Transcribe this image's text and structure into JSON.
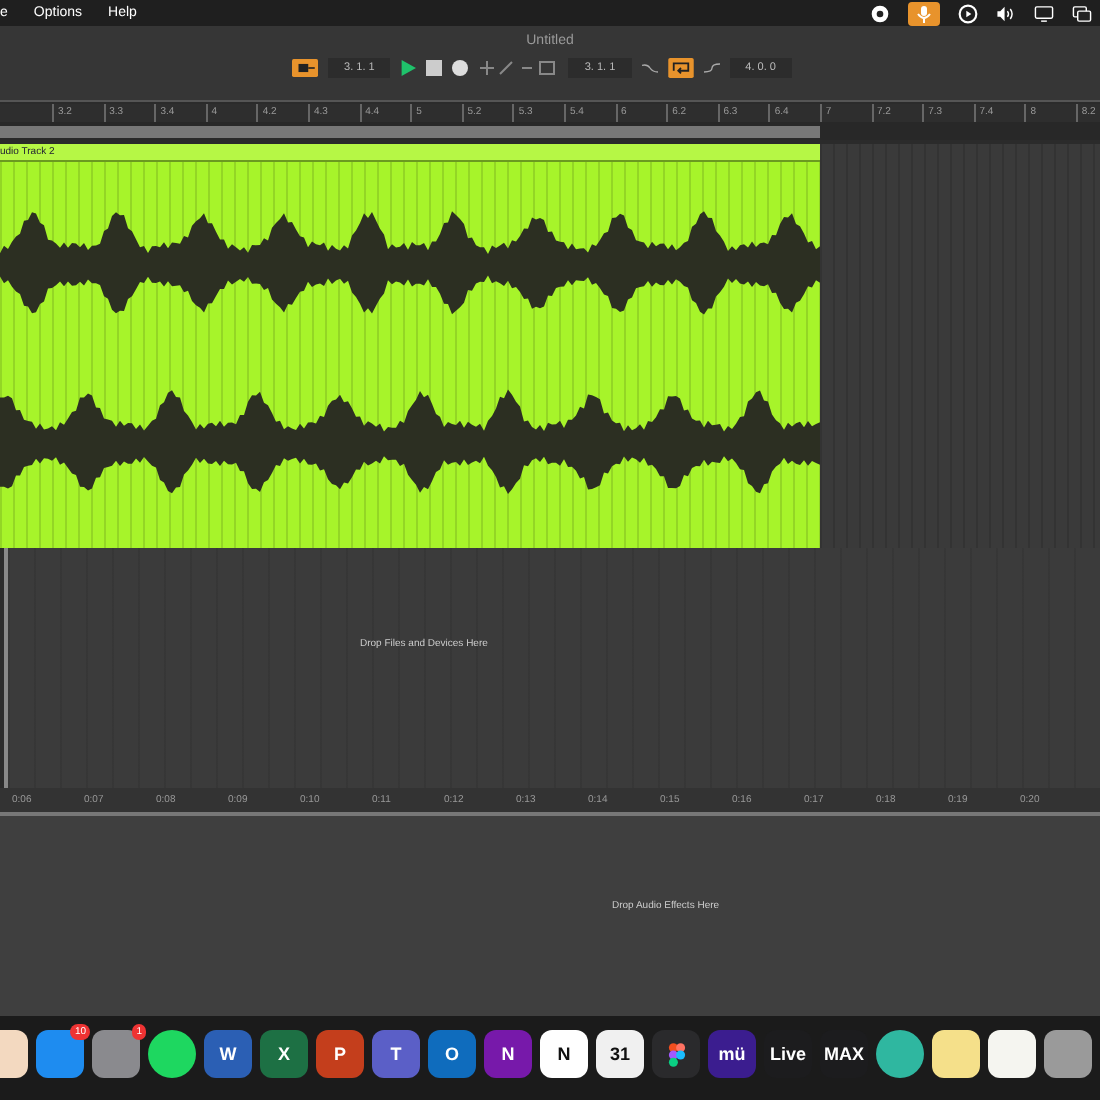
{
  "menu_bar": {
    "items": [
      "e",
      "Options",
      "Help"
    ]
  },
  "window": {
    "title": "Untitled"
  },
  "transport": {
    "position": "3. 1. 1",
    "loop_start": "3. 1. 1",
    "loop_length": "4. 0. 0"
  },
  "arrangement": {
    "ruler": [
      "3.2",
      "3.3",
      "3.4",
      "4",
      "4.2",
      "4.3",
      "4.4",
      "5",
      "5.2",
      "5.3",
      "5.4",
      "6",
      "6.2",
      "6.3",
      "6.4",
      "7",
      "7.2",
      "7.3",
      "7.4",
      "8",
      "8.2"
    ],
    "clip": {
      "name": "udio Track 2"
    },
    "drop_hint": "Drop Files and Devices Here",
    "time_ruler": [
      "0:06",
      "0:07",
      "0:08",
      "0:09",
      "0:10",
      "0:11",
      "0:12",
      "0:13",
      "0:14",
      "0:15",
      "0:16",
      "0:17",
      "0:18",
      "0:19",
      "0:20"
    ]
  },
  "device_view": {
    "drop_hint": "Drop Audio Effects Here"
  },
  "dock": [
    {
      "kind": "tile",
      "color": "#f3d9c0"
    },
    {
      "kind": "tile",
      "color": "#1e8cf0",
      "badge": "10"
    },
    {
      "kind": "tile",
      "color": "#8a8a8e",
      "badge": "1"
    },
    {
      "kind": "circle",
      "color": "#1ed760"
    },
    {
      "kind": "tile",
      "color": "#2b5fb4",
      "label": "W"
    },
    {
      "kind": "tile",
      "color": "#1d7044",
      "label": "X"
    },
    {
      "kind": "tile",
      "color": "#c43e1c",
      "label": "P"
    },
    {
      "kind": "tile",
      "color": "#5b5fc7",
      "label": "T"
    },
    {
      "kind": "tile",
      "color": "#0f6cbd",
      "label": "O"
    },
    {
      "kind": "tile",
      "color": "#7719aa",
      "label": "N"
    },
    {
      "kind": "tile",
      "color": "#ffffff",
      "label": "N"
    },
    {
      "kind": "tile",
      "color": "#f0f0f0",
      "label": "31"
    },
    {
      "kind": "dots",
      "color": "#2a2a2c"
    },
    {
      "kind": "tile",
      "color": "#3b1d8f",
      "label": "mü"
    },
    {
      "kind": "tile",
      "color": "#1c1c1e",
      "label": "Live"
    },
    {
      "kind": "tile",
      "color": "#1c1c1e",
      "label": "MAX"
    },
    {
      "kind": "circle",
      "color": "#2fb7a0"
    },
    {
      "kind": "tile",
      "color": "#f5e08a"
    },
    {
      "kind": "tile",
      "color": "#f5f5f0"
    },
    {
      "kind": "tile",
      "color": "#9a9a9a"
    }
  ]
}
